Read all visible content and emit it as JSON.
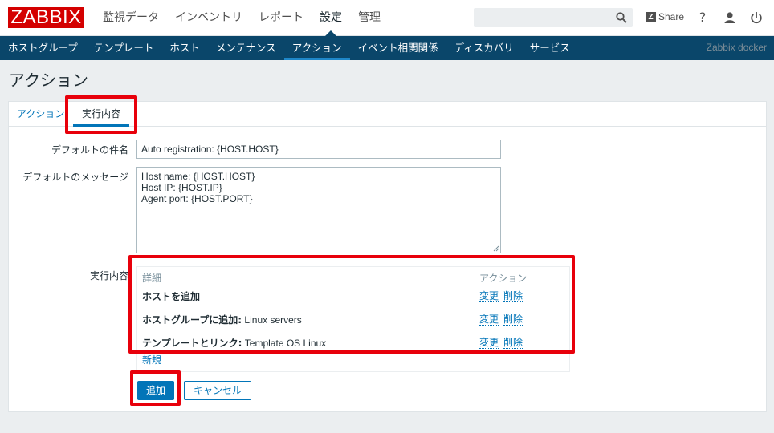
{
  "topbar": {
    "logo": "ZABBIX",
    "menu": [
      {
        "label": "監視データ"
      },
      {
        "label": "インベントリ"
      },
      {
        "label": "レポート"
      },
      {
        "label": "設定"
      },
      {
        "label": "管理"
      }
    ],
    "active_menu": "設定",
    "search_value": "",
    "share_label": "Share",
    "help_glyph": "?"
  },
  "subnav": {
    "items": [
      {
        "label": "ホストグループ"
      },
      {
        "label": "テンプレート"
      },
      {
        "label": "ホスト"
      },
      {
        "label": "メンテナンス"
      },
      {
        "label": "アクション"
      },
      {
        "label": "イベント相関関係"
      },
      {
        "label": "ディスカバリ"
      },
      {
        "label": "サービス"
      }
    ],
    "active_item": "アクション",
    "server_name": "Zabbix docker"
  },
  "page": {
    "title": "アクション"
  },
  "tabs": [
    {
      "label": "アクション"
    },
    {
      "label": "実行内容"
    }
  ],
  "form": {
    "subject_label": "デフォルトの件名",
    "subject_value": "Auto registration: {HOST.HOST}",
    "message_label": "デフォルトのメッセージ",
    "message_value": "Host name: {HOST.HOST}\nHost IP: {HOST.IP}\nAgent port: {HOST.PORT}",
    "operations_label": "実行内容",
    "operations": {
      "header_details": "詳細",
      "header_action": "アクション",
      "rows": [
        {
          "title": "ホストを追加",
          "detail": "",
          "edit": "変更",
          "delete": "削除"
        },
        {
          "title": "ホストグループに追加:",
          "detail": " Linux servers",
          "edit": "変更",
          "delete": "削除"
        },
        {
          "title": "テンプレートとリンク:",
          "detail": " Template OS Linux",
          "edit": "変更",
          "delete": "削除"
        }
      ],
      "new_link": "新規"
    },
    "add_button": "追加",
    "cancel_button": "キャンセル"
  },
  "colors": {
    "brand_red": "#d40000",
    "nav_blue": "#0a466a",
    "link_blue": "#0275b8",
    "highlight_red": "#e8000b"
  }
}
